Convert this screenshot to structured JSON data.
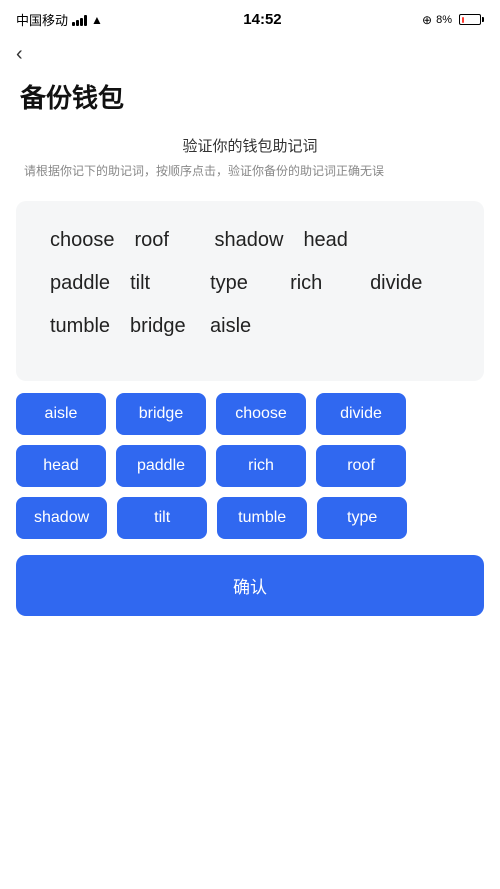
{
  "statusBar": {
    "carrier": "中国移动",
    "time": "14:52",
    "battery": "8%"
  },
  "backButton": "‹",
  "pageTitle": "备份钱包",
  "subtitleMain": "验证你的钱包助记词",
  "subtitleDesc": "请根据你记下的助记词，按顺序点击，验证你备份的助记词正确无误",
  "displayWords": [
    [
      "choose",
      "roof",
      "shadow",
      "head"
    ],
    [
      "paddle",
      "tilt",
      "type",
      "rich",
      "divide"
    ],
    [
      "tumble",
      "bridge",
      "aisle"
    ]
  ],
  "wordButtons": [
    "aisle",
    "bridge",
    "choose",
    "divide",
    "head",
    "paddle",
    "rich",
    "roof",
    "shadow",
    "tilt",
    "tumble",
    "type"
  ],
  "confirmLabel": "确认"
}
